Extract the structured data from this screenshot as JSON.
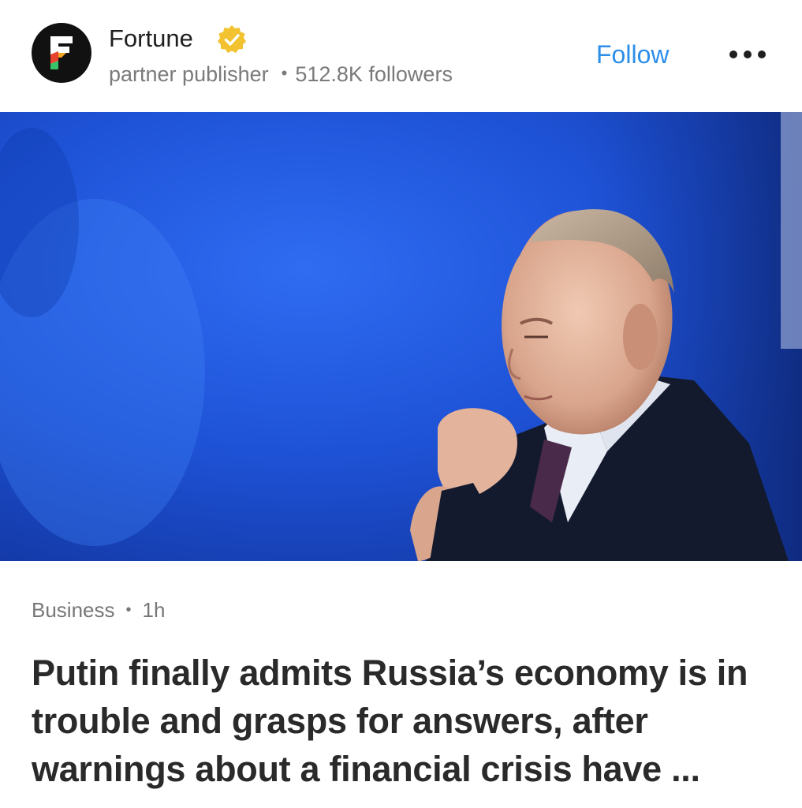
{
  "publisher": {
    "name": "Fortune",
    "verified_icon": "verified-badge-icon",
    "subtitle": "partner publisher",
    "followers": "512.8K followers",
    "logo_icon": "fortune-logo-icon"
  },
  "actions": {
    "follow_label": "Follow",
    "more_icon": "more-options-icon"
  },
  "article": {
    "category": "Business",
    "time": "1h",
    "headline": "Putin finally admits Russia’s economy is in trouble and grasps for answers, after warnings about a financial crisis have ..."
  },
  "colors": {
    "accent": "#2b8ee8",
    "verified": "#f2c230",
    "hero_background": "#1d4fd0",
    "headline_text": "#2a2a2a",
    "meta_text": "#777777"
  }
}
